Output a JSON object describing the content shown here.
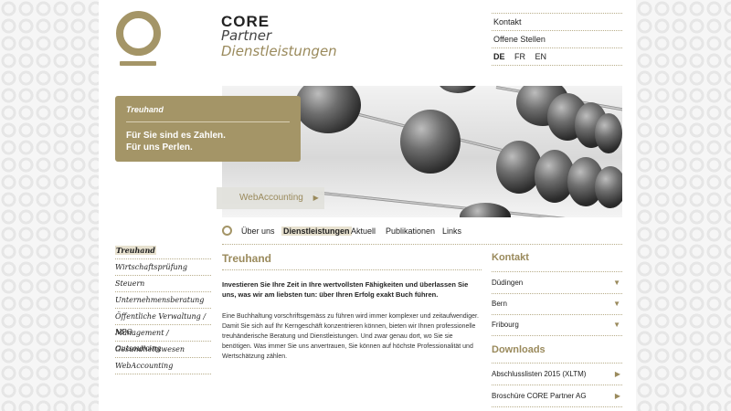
{
  "brand": {
    "core": "CORE",
    "partner": "Partner",
    "dienst": "Dienstleistungen"
  },
  "toplinks": {
    "kontakt": "Kontakt",
    "stellen": "Offene Stellen"
  },
  "languages": [
    "DE",
    "FR",
    "EN"
  ],
  "hero": {
    "box_title": "Treuhand",
    "slogan_1": "Für Sie sind es Zahlen.",
    "slogan_2": "Für uns Perlen.",
    "webaccounting": "WebAccounting"
  },
  "nav": {
    "items": [
      "Über uns",
      "Dienstleistungen",
      "Aktuell",
      "Publikationen",
      "Links"
    ],
    "active": "Dienstleistungen"
  },
  "sidebar": {
    "items": [
      "Treuhand",
      "Wirtschaftsprüfung",
      "Steuern",
      "Unternehmensberatung",
      "Öffentliche Verwaltung / NPO",
      "Management / Outsourcing",
      "Gesundheitswesen",
      "WebAccounting"
    ],
    "active": "Treuhand"
  },
  "main": {
    "title": "Treuhand",
    "lead": "Investieren Sie Ihre Zeit in Ihre wertvollsten Fähigkeiten und überlassen Sie uns, was wir am liebsten tun: über Ihren Erfolg exakt Buch führen.",
    "body": "Eine Buchhaltung vorschriftsgemäss zu führen wird immer komplexer und zeitaufwendiger. Damit Sie sich auf Ihr Kerngeschäft konzentrieren können, bieten wir Ihnen professionelle treuhänderische Beratung und Dienstleistungen. Und zwar genau dort, wo Sie sie benötigen. Was immer Sie uns anvertrauen, Sie können auf höchste Professionalität und Wertschätzung zählen."
  },
  "right": {
    "kontakt_title": "Kontakt",
    "locations": [
      "Düdingen",
      "Bern",
      "Fribourg"
    ],
    "downloads_title": "Downloads",
    "downloads": [
      "Abschlusslisten 2015 (XLTM)",
      "Broschüre CORE Partner AG"
    ]
  },
  "colors": {
    "accent": "#a49567",
    "accent_text": "#9a8a5c"
  }
}
